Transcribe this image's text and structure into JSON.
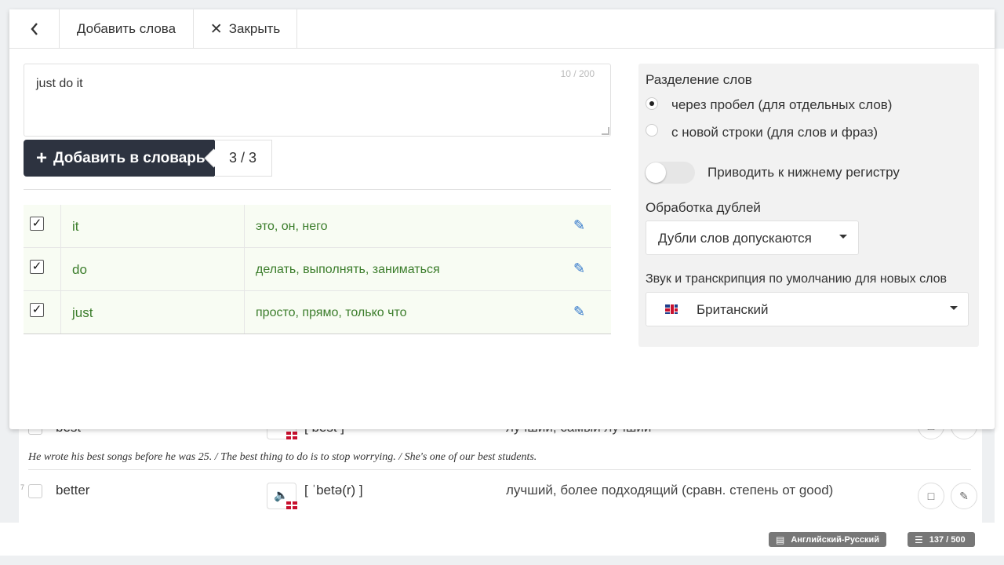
{
  "toolbar": {
    "back_icon": "chevron-left-icon",
    "title": "Добавить слова",
    "close_label": "Закрыть"
  },
  "input": {
    "value": "just do it",
    "counter": "10 / 200"
  },
  "add_button": {
    "label": "Добавить в словарь",
    "count": "3 / 3"
  },
  "words": [
    {
      "word": "it",
      "translation": "это, он, него",
      "checked": true
    },
    {
      "word": "do",
      "translation": "делать, выполнять, заниматься",
      "checked": true
    },
    {
      "word": "just",
      "translation": "просто, прямо, только что",
      "checked": true
    }
  ],
  "settings": {
    "split_title": "Разделение слов",
    "split_space": "через пробел (для отдельных слов)",
    "split_newline": "с новой строки (для слов и фраз)",
    "lowercase_label": "Приводить к нижнему регистру",
    "dup_title": "Обработка дублей",
    "dup_value": "Дубли слов допускаются",
    "sound_title": "Звук и транскрипция по умолчанию для новых слов",
    "sound_value": "Британский"
  },
  "background_list": {
    "row1": {
      "word": "best",
      "transcription": "[ best ]",
      "translation": "лучший, самый лучший"
    },
    "example": "He wrote his best songs before he was 25. / The best thing to do is to stop worrying. / She's one of our best students.",
    "row2_num": "7",
    "row2": {
      "word": "better",
      "transcription": "[ ˈbetə(r) ]",
      "translation": "лучший, более подходящий (сравн. степень от good)"
    }
  },
  "footer": {
    "dictionary": "Английский-Русский",
    "count": "137 / 500"
  },
  "colors": {
    "accent_dark": "#2d3340",
    "word_green": "#3b7d2b",
    "edit_blue": "#2a72c9"
  }
}
